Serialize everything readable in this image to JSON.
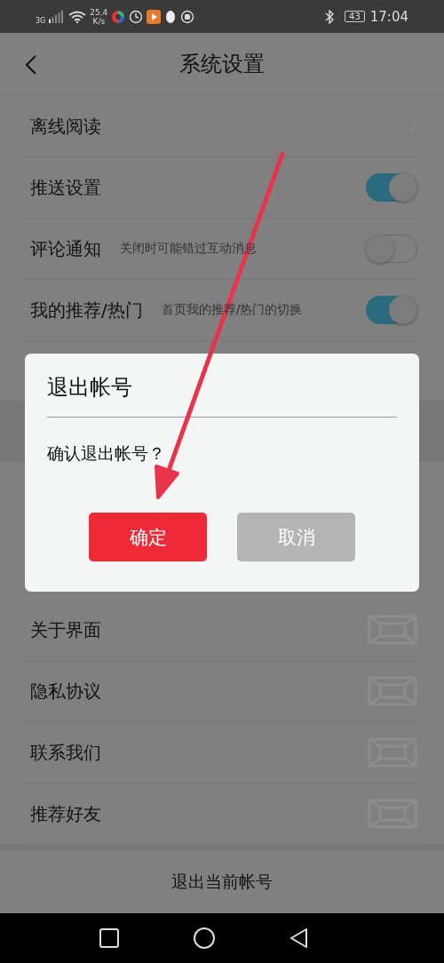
{
  "status_bar": {
    "network": "3G",
    "speed": "25.4",
    "speed_unit": "K/s",
    "battery": "43",
    "time": "17:04"
  },
  "header": {
    "title": "系统设置"
  },
  "settings_top": [
    {
      "kind": "chevron",
      "label": "离线阅读"
    },
    {
      "kind": "toggle",
      "label": "推送设置",
      "on": true
    },
    {
      "kind": "toggle",
      "label": "评论通知",
      "hint": "关闭时可能错过互动消息",
      "on": false
    },
    {
      "kind": "toggle",
      "label": "我的推荐/热门",
      "hint": "首页我的推荐/热门的切换",
      "on": true
    }
  ],
  "settings_bottom": [
    {
      "kind": "icon",
      "label": "关于界面"
    },
    {
      "kind": "icon",
      "label": "隐私协议"
    },
    {
      "kind": "icon",
      "label": "联系我们"
    },
    {
      "kind": "icon",
      "label": "推荐好友"
    }
  ],
  "logout_button": "退出当前帐号",
  "dialog": {
    "title": "退出帐号",
    "message": "确认退出帐号？",
    "buttons": [
      {
        "label": "确定",
        "kind": "primary"
      },
      {
        "label": "取消",
        "kind": "secondary"
      }
    ]
  }
}
